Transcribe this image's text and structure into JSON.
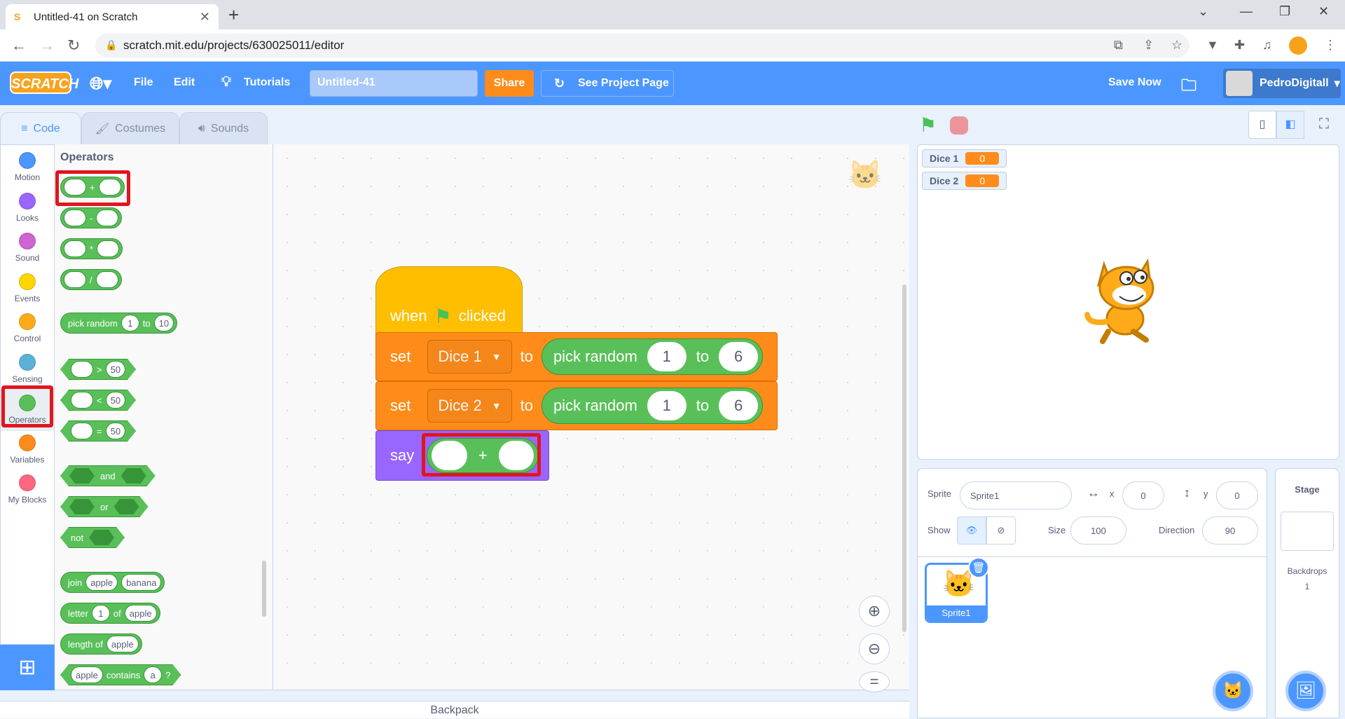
{
  "browser": {
    "tab_title": "Untitled-41 on Scratch",
    "url": "scratch.mit.edu/projects/630025011/editor"
  },
  "menu": {
    "logo": "SCRATCH",
    "file": "File",
    "edit": "Edit",
    "tutorials": "Tutorials",
    "project_title": "Untitled-41",
    "share": "Share",
    "see_project": "See Project Page",
    "save_now": "Save Now",
    "username": "PedroDigitall"
  },
  "editor_tabs": {
    "code": "Code",
    "costumes": "Costumes",
    "sounds": "Sounds"
  },
  "categories": [
    {
      "label": "Motion",
      "color": "#4c97ff"
    },
    {
      "label": "Looks",
      "color": "#9966ff"
    },
    {
      "label": "Sound",
      "color": "#cf63cf"
    },
    {
      "label": "Events",
      "color": "#ffd500"
    },
    {
      "label": "Control",
      "color": "#ffab19"
    },
    {
      "label": "Sensing",
      "color": "#5cb1d6"
    },
    {
      "label": "Operators",
      "color": "#59c059"
    },
    {
      "label": "Variables",
      "color": "#ff8c1a"
    },
    {
      "label": "My Blocks",
      "color": "#ff6680"
    }
  ],
  "palette": {
    "title": "Operators",
    "add": "+",
    "sub": "-",
    "mul": "*",
    "div": "/",
    "pick_random": "pick random",
    "pick_from": "1",
    "pick_to_word": "to",
    "pick_to": "10",
    "gt": ">",
    "lt": "<",
    "eq": "=",
    "cmp_value": "50",
    "and": "and",
    "or": "or",
    "not": "not",
    "join": "join",
    "join_a": "apple",
    "join_b": "banana",
    "letter": "letter",
    "letter_n": "1",
    "letter_of": "of",
    "letter_word": "apple",
    "length_of": "length of",
    "length_word": "apple",
    "contains_word": "apple",
    "contains": "contains",
    "contains_char": "a",
    "contains_q": "?"
  },
  "script": {
    "when": "when",
    "clicked": "clicked",
    "set": "set",
    "to": "to",
    "var1": "Dice 1",
    "var2": "Dice 2",
    "pick_random": "pick random",
    "from": "1",
    "to_word": "to",
    "max": "6",
    "say": "say",
    "plus": "+"
  },
  "stage": {
    "monitors": [
      {
        "name": "Dice 1",
        "value": "0"
      },
      {
        "name": "Dice 2",
        "value": "0"
      }
    ]
  },
  "sprite_info": {
    "sprite_label": "Sprite",
    "sprite_name": "Sprite1",
    "x_label": "x",
    "x": "0",
    "y_label": "y",
    "y": "0",
    "show_label": "Show",
    "size_label": "Size",
    "size": "100",
    "direction_label": "Direction",
    "direction": "90"
  },
  "sprites": [
    {
      "name": "Sprite1"
    }
  ],
  "stage_panel": {
    "title": "Stage",
    "backdrops_label": "Backdrops",
    "backdrops_count": "1"
  },
  "backpack": "Backpack"
}
